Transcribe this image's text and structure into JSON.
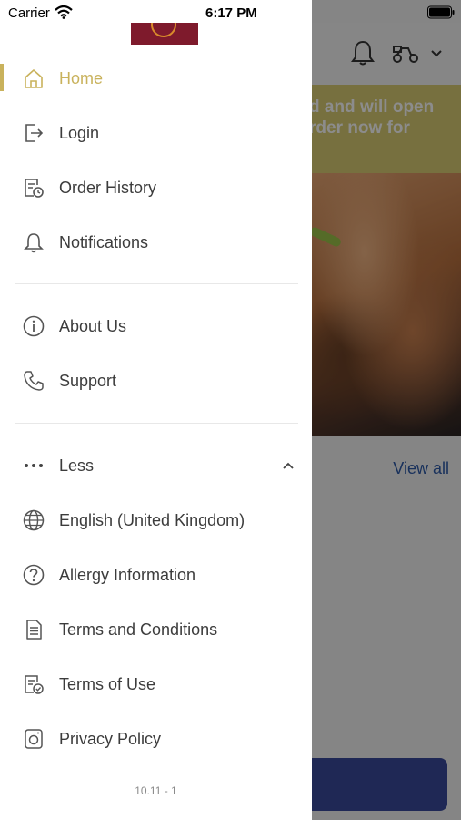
{
  "status_bar": {
    "carrier": "Carrier",
    "time": "6:17 PM"
  },
  "background": {
    "banner_line1": "d and will open",
    "banner_line2": "rder now for",
    "view_all_label": "View all",
    "banner_color": "#d9cc74"
  },
  "drawer": {
    "accent_color": "#c9b25c",
    "group1": [
      {
        "label": "Home",
        "icon": "home-icon",
        "active": true
      },
      {
        "label": "Login",
        "icon": "login-icon"
      },
      {
        "label": "Order History",
        "icon": "order-history-icon"
      },
      {
        "label": "Notifications",
        "icon": "bell-icon"
      }
    ],
    "group2": [
      {
        "label": "About Us",
        "icon": "info-icon"
      },
      {
        "label": "Support",
        "icon": "phone-icon"
      }
    ],
    "group3": [
      {
        "label": "Less",
        "icon": "more-dots-icon"
      },
      {
        "label": "English (United Kingdom)",
        "icon": "globe-icon"
      },
      {
        "label": "Allergy Information",
        "icon": "question-icon"
      },
      {
        "label": "Terms and Conditions",
        "icon": "document-icon"
      },
      {
        "label": "Terms of Use",
        "icon": "document-check-icon"
      },
      {
        "label": "Privacy Policy",
        "icon": "privacy-icon"
      }
    ],
    "version": "10.11 - 1"
  }
}
